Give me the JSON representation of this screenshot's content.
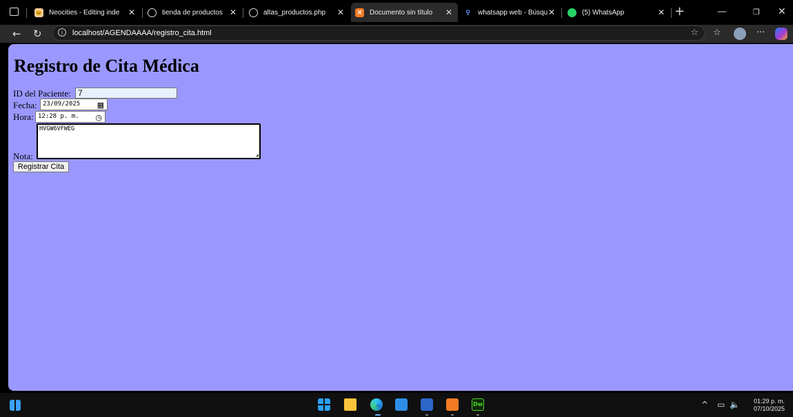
{
  "tabs": [
    {
      "label": "Neocities - Editing inde",
      "icon": "neocities-cat-icon"
    },
    {
      "label": "tienda de productos",
      "icon": "globe-icon"
    },
    {
      "label": "altas_productos.php",
      "icon": "globe-icon"
    },
    {
      "label": "Documento sin título",
      "icon": "xampp-icon"
    },
    {
      "label": "whatsapp web - Búsqu",
      "icon": "search-icon"
    },
    {
      "label": "(5) WhatsApp",
      "icon": "whatsapp-icon"
    }
  ],
  "address_bar": {
    "url": "localhost/AGENDAAAA/registro_cita.html"
  },
  "page": {
    "title": "Registro de Cita Médica",
    "id_label": "ID del Paciente:",
    "id_value": "7",
    "fecha_label": "Fecha:",
    "fecha_value": "23/09/2025",
    "hora_label": "Hora:",
    "hora_value": "12:28 p. m.",
    "nota_label": "Nota:",
    "nota_value": "HVGW6VFWEG",
    "submit_label": "Registrar Cita"
  },
  "colors": {
    "page_background": "#9a98fe",
    "input_autofill": "#e8f0fe"
  },
  "taskbar": {
    "apps": [
      "windows-start-icon",
      "file-explorer-icon",
      "edge-icon",
      "store-icon",
      "word-icon",
      "xampp-icon",
      "dreamweaver-icon"
    ],
    "time": "01:29 p. m.",
    "date": "07/10/2025"
  }
}
